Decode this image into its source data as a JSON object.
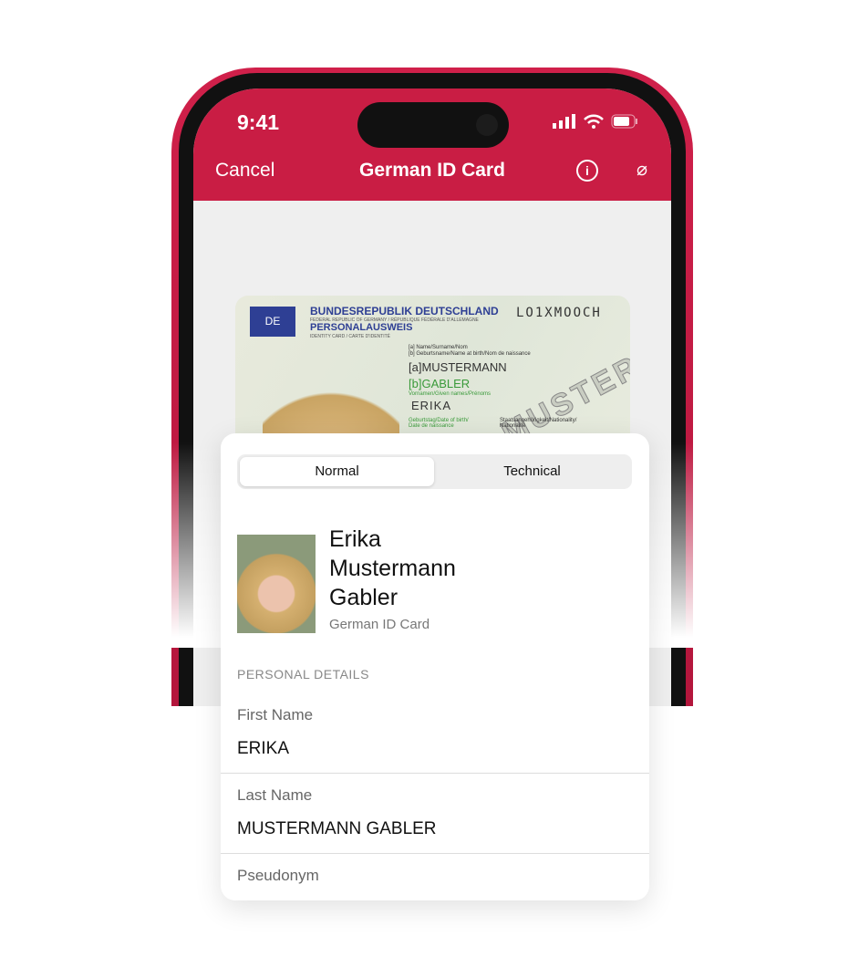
{
  "status_bar": {
    "time": "9:41"
  },
  "nav": {
    "cancel": "Cancel",
    "title": "German ID Card",
    "info_icon": "info-icon",
    "torch_icon": "flashlight-off-icon"
  },
  "id_card": {
    "country_code": "DE",
    "issuer": "BUNDESREPUBLIK DEUTSCHLAND",
    "issuer_sub": "FEDERAL REPUBLIC OF GERMANY / RÉPUBLIQUE FÉDÉRALE D'ALLEMAGNE",
    "doc_type": "PERSONALAUSWEIS",
    "doc_sub": "IDENTITY CARD / CARTE D'IDENTITÉ",
    "number": "LO1XMOOCH",
    "surname_label": "[a] Name/Surname/Nom",
    "birthname_label": "[b] Geburtsname/Name at birth/Nom de naissance",
    "surname": "[a]MUSTERMANN",
    "birthname": "[b]GABLER",
    "given_label": "Vornamen/Given names/Prénoms",
    "given": "ERIKA",
    "dob_label": "Geburtstag/Date of birth/ Date de naissance",
    "nationality_label": "Staatsangehörigkeit/Nationality/ Nationalité",
    "watermark": "MUSTER"
  },
  "tabs": [
    {
      "label": "Normal",
      "selected": true
    },
    {
      "label": "Technical",
      "selected": false
    }
  ],
  "profile": {
    "name_line1": "Erika",
    "name_line2": "Mustermann",
    "name_line3": "Gabler",
    "document": "German ID Card"
  },
  "section": "PERSONAL DETAILS",
  "fields": [
    {
      "label": "First Name",
      "value": "ERIKA"
    },
    {
      "label": "Last Name",
      "value": "MUSTERMANN GABLER"
    },
    {
      "label": "Pseudonym",
      "value": ""
    }
  ],
  "colors": {
    "accent": "#c91d44"
  }
}
